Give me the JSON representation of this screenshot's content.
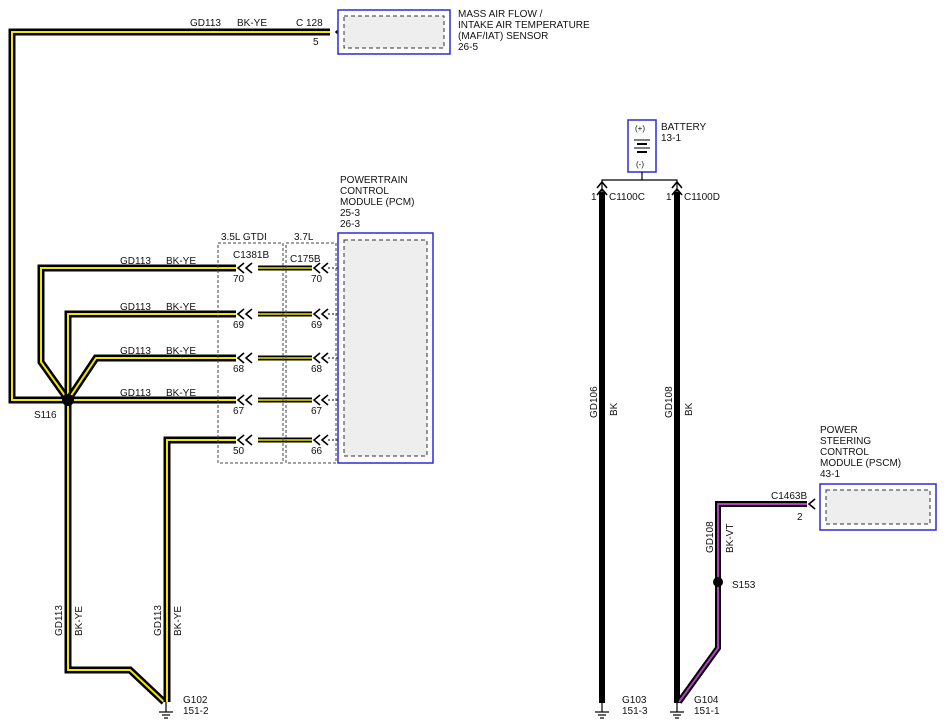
{
  "components": {
    "maf": {
      "lines": [
        "MASS AIR FLOW /",
        "INTAKE AIR TEMPERATURE",
        "(MAF/IAT) SENSOR",
        "26-5"
      ]
    },
    "pcm": {
      "lines": [
        "POWERTRAIN",
        "CONTROL",
        "MODULE (PCM)",
        "25-3",
        "26-3"
      ]
    },
    "battery": {
      "lines": [
        "BATTERY",
        "13-1"
      ],
      "plus": "(+)",
      "minus": "(-)"
    },
    "pscm": {
      "lines": [
        "POWER",
        "STEERING",
        "CONTROL",
        "MODULE (PSCM)",
        "43-1"
      ]
    }
  },
  "connectors": {
    "c128": {
      "name": "C 128",
      "pin": "5"
    },
    "c1381b": {
      "name": "C1381B",
      "variant": "3.5L GTDI",
      "pins": [
        "70",
        "69",
        "68",
        "67",
        "50"
      ]
    },
    "c175b": {
      "name": "C175B",
      "variant": "3.7L",
      "pins": [
        "70",
        "69",
        "68",
        "67",
        "66"
      ]
    },
    "c1100c": {
      "name": "C1100C",
      "pin": "1"
    },
    "c1100d": {
      "name": "C1100D",
      "pin": "1"
    },
    "c1463b": {
      "name": "C1463B",
      "pin": "2"
    }
  },
  "circuits": {
    "gd113": "GD113",
    "bk_ye": "BK-YE",
    "gd106": "GD106",
    "bk": "BK",
    "gd108": "GD108",
    "bk_vt": "BK-VT"
  },
  "splices": {
    "s116": "S116",
    "s153": "S153"
  },
  "grounds": {
    "g102": {
      "name": "G102",
      "ref": "151-2"
    },
    "g103": {
      "name": "G103",
      "ref": "151-3"
    },
    "g104": {
      "name": "G104",
      "ref": "151-1"
    }
  },
  "colors": {
    "wire_black": "#000000",
    "stripe_yellow": "#f2e600",
    "stripe_violet": "#b040c0",
    "component_outline": "#2b2bd6",
    "component_fill": "#eeeeee"
  }
}
